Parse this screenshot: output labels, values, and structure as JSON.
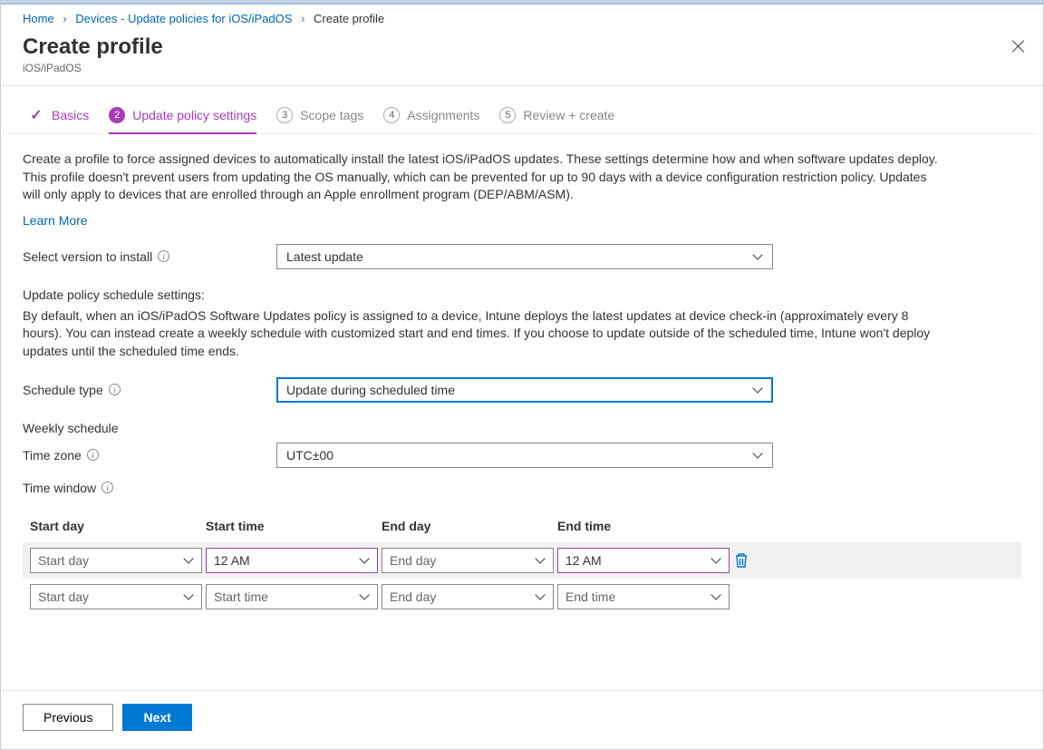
{
  "breadcrumb": {
    "home": "Home",
    "devices": "Devices - Update policies for iOS/iPadOS",
    "current": "Create profile"
  },
  "header": {
    "title": "Create profile",
    "subtitle": "iOS/iPadOS"
  },
  "tabs": {
    "basics": "Basics",
    "settings_num": "2",
    "settings": "Update policy settings",
    "scope_num": "3",
    "scope": "Scope tags",
    "assign_num": "4",
    "assign": "Assignments",
    "review_num": "5",
    "review": "Review + create"
  },
  "body": {
    "description": "Create a profile to force assigned devices to automatically install the latest iOS/iPadOS updates. These settings determine how and when software updates deploy. This profile doesn't prevent users from updating the OS manually, which can be prevented for up to 90 days with a device configuration restriction policy. Updates will only apply to devices that are enrolled through an Apple enrollment program (DEP/ABM/ASM).",
    "learn_more": "Learn More",
    "version_label": "Select version to install",
    "version_value": "Latest update",
    "schedule_heading": "Update policy schedule settings:",
    "schedule_text": "By default, when an iOS/iPadOS Software Updates policy is assigned to a device, Intune deploys the latest updates at device check-in (approximately every 8 hours). You can instead create a weekly schedule with customized start and end times. If you choose to update outside of the scheduled time, Intune won't deploy updates until the scheduled time ends.",
    "schedule_type_label": "Schedule type",
    "schedule_type_value": "Update during scheduled time",
    "weekly_heading": "Weekly schedule",
    "tz_label": "Time zone",
    "tz_value": "UTC±00",
    "tw_label": "Time window"
  },
  "table": {
    "headers": {
      "c1": "Start day",
      "c2": "Start time",
      "c3": "End day",
      "c4": "End time"
    },
    "rows": [
      {
        "c1": "Start day",
        "c2": "12 AM",
        "c3": "End day",
        "c4": "12 AM",
        "c1_ph": true,
        "c2_ph": false,
        "c3_ph": true,
        "c4_ph": false
      },
      {
        "c1": "Start day",
        "c2": "Start time",
        "c3": "End day",
        "c4": "End time",
        "c1_ph": true,
        "c2_ph": true,
        "c3_ph": true,
        "c4_ph": true
      }
    ]
  },
  "footer": {
    "prev": "Previous",
    "next": "Next"
  }
}
